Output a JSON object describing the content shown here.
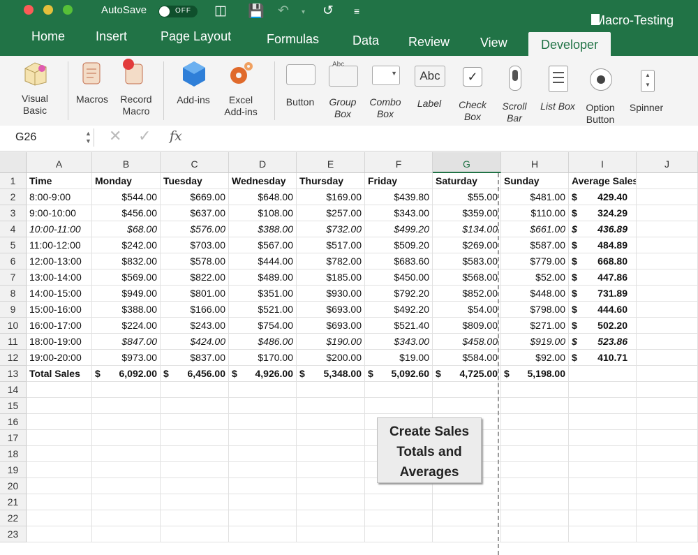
{
  "titlebar": {
    "autosave_label": "AutoSave",
    "autosave_state": "OFF",
    "doc_title": "Macro-Testing"
  },
  "tabs": [
    "Home",
    "Insert",
    "Page Layout",
    "Formulas",
    "Data",
    "Review",
    "View"
  ],
  "active_tab": "Developer",
  "ribbon": {
    "visual_basic": "Visual Basic",
    "macros": "Macros",
    "record_macro": "Record Macro",
    "add_ins": "Add-ins",
    "excel_add_ins": "Excel Add-ins",
    "button": "Button",
    "group_box": "Group Box",
    "combo_box": "Combo Box",
    "label": "Label",
    "check_box": "Check Box",
    "scroll_bar": "Scroll Bar",
    "list_box": "List Box",
    "option_button": "Option Button",
    "spinner": "Spinner",
    "group_box_icon_text": "Abc",
    "label_icon_text": "Abc"
  },
  "formula_bar": {
    "name_box": "G26",
    "fx_label": "fx"
  },
  "columns": [
    "A",
    "B",
    "C",
    "D",
    "E",
    "F",
    "G",
    "H",
    "I",
    "J"
  ],
  "selected_column": "G",
  "row_numbers": [
    "1",
    "2",
    "3",
    "4",
    "5",
    "6",
    "7",
    "8",
    "9",
    "10",
    "11",
    "12",
    "13",
    "14",
    "15",
    "16",
    "17",
    "18",
    "19",
    "20",
    "21",
    "22",
    "23"
  ],
  "headers": [
    "Time",
    "Monday",
    "Tuesday",
    "Wednesday",
    "Thursday",
    "Friday",
    "Saturday",
    "Sunday",
    "Average Sales"
  ],
  "rows": [
    {
      "time": "8:00-9:00",
      "vals": [
        "$544.00",
        "$669.00",
        "$648.00",
        "$169.00",
        "$439.80",
        "$55.00",
        "$481.00"
      ],
      "avg": "429.40"
    },
    {
      "time": "9:00-10:00",
      "vals": [
        "$456.00",
        "$637.00",
        "$108.00",
        "$257.00",
        "$343.00",
        "$359.00",
        "$110.00"
      ],
      "avg": "324.29"
    },
    {
      "time": "10:00-11:00",
      "vals": [
        "$68.00",
        "$576.00",
        "$388.00",
        "$732.00",
        "$499.20",
        "$134.00",
        "$661.00"
      ],
      "avg": "436.89"
    },
    {
      "time": "11:00-12:00",
      "vals": [
        "$242.00",
        "$703.00",
        "$567.00",
        "$517.00",
        "$509.20",
        "$269.00",
        "$587.00"
      ],
      "avg": "484.89"
    },
    {
      "time": "12:00-13:00",
      "vals": [
        "$832.00",
        "$578.00",
        "$444.00",
        "$782.00",
        "$683.60",
        "$583.00",
        "$779.00"
      ],
      "avg": "668.80"
    },
    {
      "time": "13:00-14:00",
      "vals": [
        "$569.00",
        "$822.00",
        "$489.00",
        "$185.00",
        "$450.00",
        "$568.00",
        "$52.00"
      ],
      "avg": "447.86"
    },
    {
      "time": "14:00-15:00",
      "vals": [
        "$949.00",
        "$801.00",
        "$351.00",
        "$930.00",
        "$792.20",
        "$852.00",
        "$448.00"
      ],
      "avg": "731.89"
    },
    {
      "time": "15:00-16:00",
      "vals": [
        "$388.00",
        "$166.00",
        "$521.00",
        "$693.00",
        "$492.20",
        "$54.00",
        "$798.00"
      ],
      "avg": "444.60"
    },
    {
      "time": "16:00-17:00",
      "vals": [
        "$224.00",
        "$243.00",
        "$754.00",
        "$693.00",
        "$521.40",
        "$809.00",
        "$271.00"
      ],
      "avg": "502.20"
    },
    {
      "time": "18:00-19:00",
      "vals": [
        "$847.00",
        "$424.00",
        "$486.00",
        "$190.00",
        "$343.00",
        "$458.00",
        "$919.00"
      ],
      "avg": "523.86"
    },
    {
      "time": "19:00-20:00",
      "vals": [
        "$973.00",
        "$837.00",
        "$170.00",
        "$200.00",
        "$19.00",
        "$584.00",
        "$92.00"
      ],
      "avg": "410.71"
    }
  ],
  "currency_symbol": "$",
  "totals": {
    "label": "Total Sales",
    "vals": [
      "6,092.00",
      "6,456.00",
      "4,926.00",
      "5,348.00",
      "5,092.60",
      "4,725.00",
      "5,198.00"
    ]
  },
  "macro_button": {
    "label": "Create Sales Totals and Averages"
  },
  "colors": {
    "excel_green": "#217346",
    "close": "#fc5b57",
    "minimize": "#e5bf3c",
    "maximize": "#57c038"
  }
}
